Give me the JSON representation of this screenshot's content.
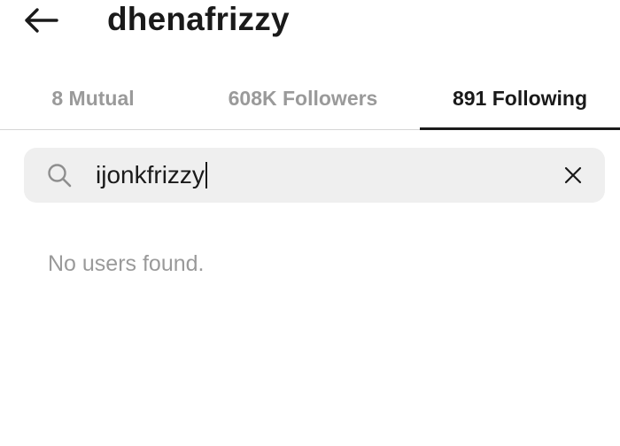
{
  "header": {
    "back_icon": "arrow-left-icon",
    "username": "dhenafrizzy"
  },
  "tabs": [
    {
      "label": "8 Mutual",
      "active": false
    },
    {
      "label": "608K Followers",
      "active": false
    },
    {
      "label": "891 Following",
      "active": true
    }
  ],
  "search": {
    "icon": "search-icon",
    "value": "ijonkfrizzy",
    "clear_icon": "close-icon"
  },
  "results": {
    "empty_message": "No users found."
  },
  "colors": {
    "text_primary": "#1a1a1a",
    "text_muted": "#9a9a9a",
    "search_bg": "#efefef",
    "divider": "#d6d6d6"
  }
}
